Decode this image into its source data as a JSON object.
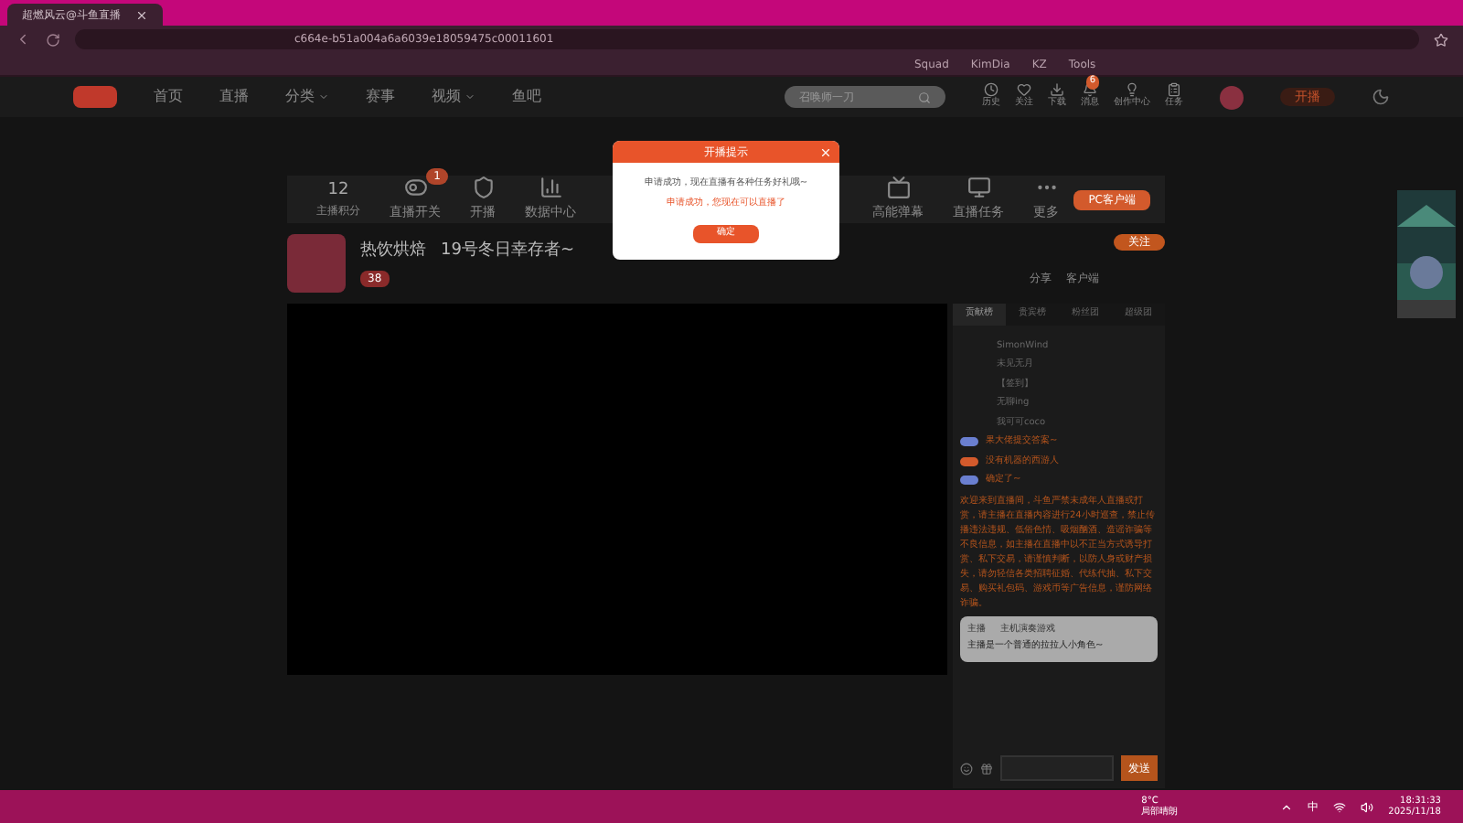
{
  "browser": {
    "tab_title": "超燃风云@斗鱼直播",
    "url": "c664e-b51a004a6a6039e18059475c00011601",
    "bookmarks": [
      "Squad",
      "KimDia",
      "KZ",
      "Tools"
    ]
  },
  "site": {
    "nav": [
      {
        "label": "首页",
        "dropdown": false
      },
      {
        "label": "直播",
        "dropdown": false
      },
      {
        "label": "分类",
        "dropdown": true
      },
      {
        "label": "赛事",
        "dropdown": false
      },
      {
        "label": "视频",
        "dropdown": true
      },
      {
        "label": "鱼吧",
        "dropdown": false
      }
    ],
    "search": {
      "placeholder": "召唤师一刀"
    },
    "actions": [
      {
        "label": "历史"
      },
      {
        "label": "关注"
      },
      {
        "label": "下载"
      },
      {
        "label": "消息",
        "badge": "6"
      },
      {
        "label": "创作中心"
      },
      {
        "label": "任务"
      }
    ],
    "go_live": "开播"
  },
  "toolbar": {
    "score": "12",
    "score_label": "主播积分",
    "left_tools": [
      {
        "label": "直播开关",
        "badge": "1"
      },
      {
        "label": "开播"
      },
      {
        "label": "数据中心"
      }
    ],
    "right_tools": [
      {
        "label": "高能弹幕"
      },
      {
        "label": "直播任务"
      },
      {
        "label": "更多"
      }
    ],
    "client_button": "PC客户端"
  },
  "stream": {
    "streamer": "热饮烘焙",
    "title": "19号冬日幸存者~",
    "level": "38",
    "follow": "关注",
    "links": [
      "分享",
      "客户端"
    ]
  },
  "modal": {
    "title": "开播提示",
    "message": "申请成功，现在直播有各种任务好礼哦~",
    "notice": "申请成功，您现在可以直播了",
    "confirm": "确定"
  },
  "chat": {
    "tabs": [
      {
        "label": "贡献榜",
        "selected": true
      },
      {
        "label": "贵宾榜",
        "selected": false
      },
      {
        "label": "粉丝团",
        "selected": false
      },
      {
        "label": "超级团",
        "selected": false
      }
    ],
    "ranking": [
      "SimonWind",
      "未见无月",
      "【签到】",
      "无聊ing",
      "我可可coco"
    ],
    "messages": [
      {
        "text": "果大佬提交答案~",
        "color": "#6a7fd0"
      },
      {
        "text": "没有机器的西游人",
        "color": "#d35a2c"
      },
      {
        "text": "确定了~",
        "color": "#6a7fd0"
      }
    ],
    "notice": "欢迎来到直播间，斗鱼严禁未成年人直播或打赏，请主播在直播内容进行24小时巡查，禁止传播违法违规、低俗色情、吸烟酗酒、造谣诈骗等不良信息，如主播在直播中以不正当方式诱导打赏、私下交易，请谨慎判断，以防人身或财产损失，请勿轻信各类招聘征婚、代练代抽、私下交易、购买礼包码、游戏币等广告信息，谨防网络诈骗。",
    "pinned": {
      "name": "主播",
      "tag": "主机演奏游戏",
      "text": "主播是一个普通的拉拉人小角色~"
    },
    "send": "发送"
  },
  "taskbar": {
    "temperature": "8°C",
    "weather": "局部晴朗",
    "ime": "中",
    "time": "18:31:33",
    "date": "2025/11/18"
  }
}
